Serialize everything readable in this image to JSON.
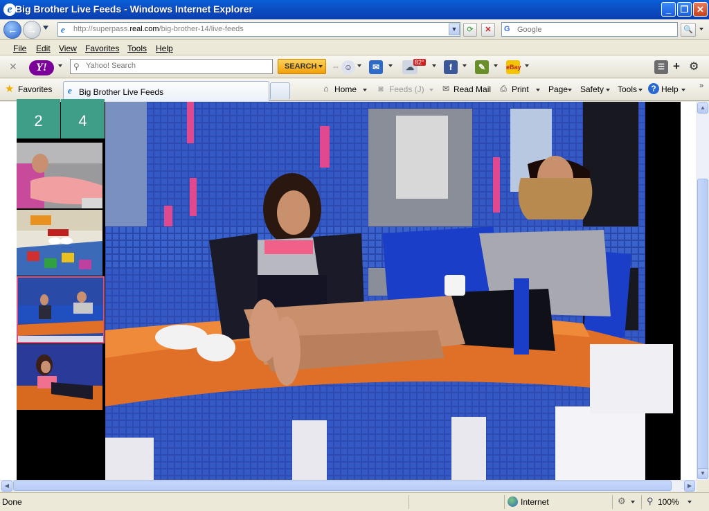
{
  "window": {
    "title": "Big Brother Live Feeds - Windows Internet Explorer"
  },
  "address": {
    "url_prefix": "http://superpass.",
    "url_domain": "real.com",
    "url_suffix": "/big-brother-14/live-feeds",
    "search_placeholder": "Google"
  },
  "menu": {
    "items": [
      "File",
      "Edit",
      "View",
      "Favorites",
      "Tools",
      "Help"
    ]
  },
  "yahoo": {
    "search_placeholder": "Yahoo! Search",
    "search_button": "SEARCH",
    "weather": "82°"
  },
  "favorites": {
    "label": "Favorites",
    "tab_title": "Big Brother Live Feeds"
  },
  "commands": {
    "home": "Home",
    "feeds": "Feeds (J)",
    "read_mail": "Read Mail",
    "print": "Print",
    "page": "Page",
    "safety": "Safety",
    "tools": "Tools",
    "help": "Help"
  },
  "cameras": {
    "buttons": [
      "2",
      "4"
    ],
    "selected_thumbnail": 3
  },
  "status": {
    "text": "Done",
    "zone": "Internet",
    "zoom": "100%"
  }
}
